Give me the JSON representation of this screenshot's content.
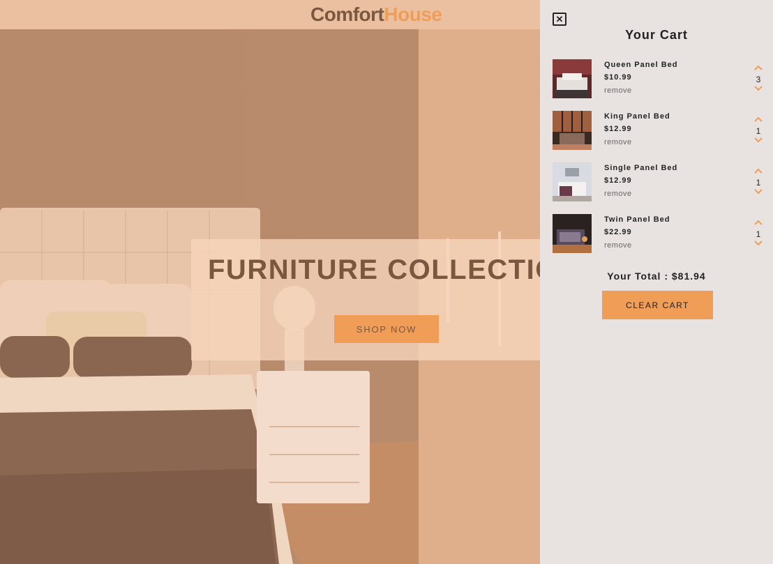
{
  "brand": {
    "part1": "Comfort",
    "part2": "House"
  },
  "hero": {
    "title": "FURNITURE COLLECTION",
    "button": "SHOP NOW"
  },
  "cart": {
    "title": "Your Cart",
    "close_icon": "close-box-icon",
    "items": [
      {
        "name": "Queen Panel Bed",
        "price": "$10.99",
        "remove": "remove",
        "qty": "3"
      },
      {
        "name": "King Panel Bed",
        "price": "$12.99",
        "remove": "remove",
        "qty": "1"
      },
      {
        "name": "Single Panel Bed",
        "price": "$12.99",
        "remove": "remove",
        "qty": "1"
      },
      {
        "name": "Twin Panel Bed",
        "price": "$22.99",
        "remove": "remove",
        "qty": "1"
      }
    ],
    "total_label": "Your Total : $81.94",
    "clear_button": "CLEAR CART"
  },
  "colors": {
    "accent": "#f09d57",
    "brand_dark": "#7a5840",
    "cart_bg": "#e8e3e0",
    "navbar": "#eac0a0"
  }
}
